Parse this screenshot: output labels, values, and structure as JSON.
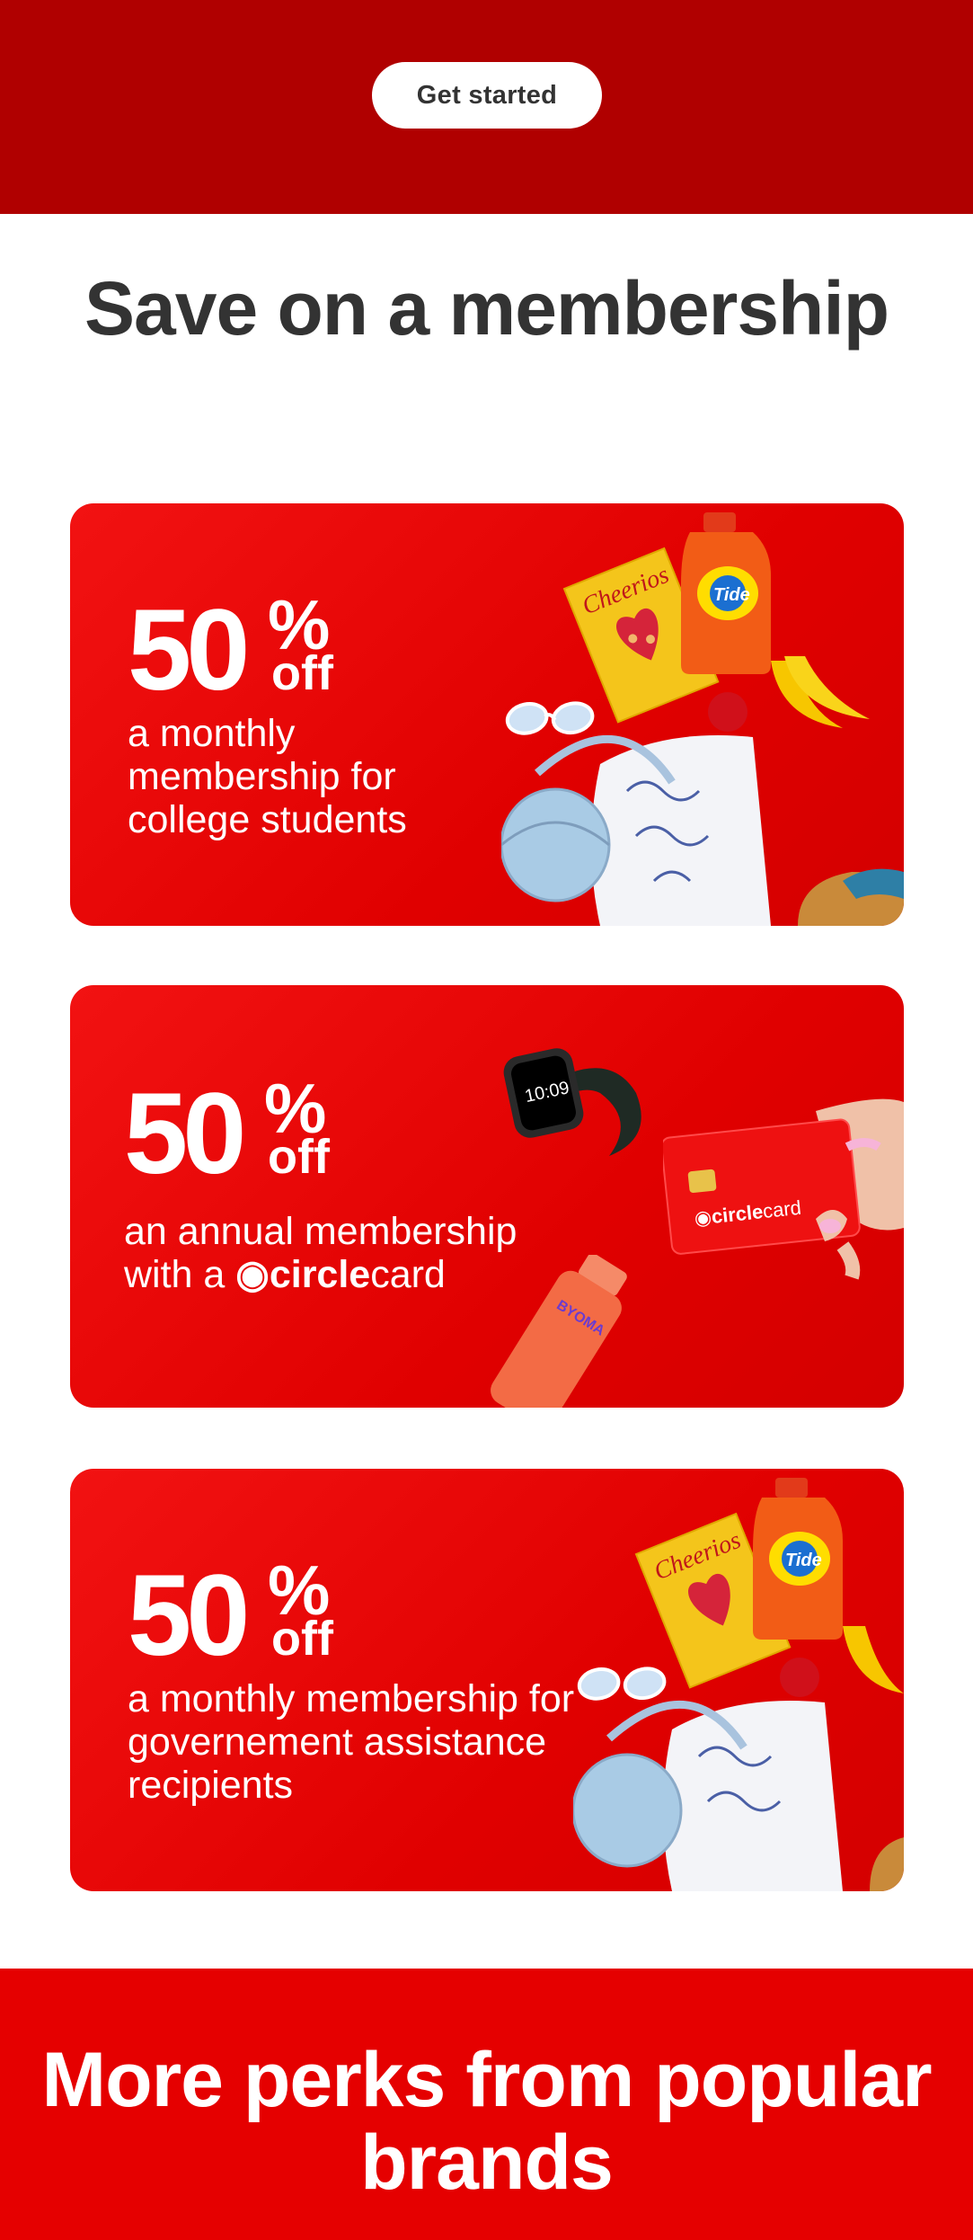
{
  "header": {
    "cta_label": "Get started"
  },
  "section": {
    "heading": "Save on a membership"
  },
  "offers": [
    {
      "percent": "50",
      "percent_symbol": "%",
      "off": "off",
      "description": "a monthly membership for college students"
    },
    {
      "percent": "50",
      "percent_symbol": "%",
      "off": "off",
      "description_prefix": "an annual membership",
      "description_line2_prefix": "with a",
      "circle_brand": "circle",
      "circle_card": "card",
      "card_brand": "circle",
      "card_word": "card"
    },
    {
      "percent": "50",
      "percent_symbol": "%",
      "off": "off",
      "description": "a monthly membership for governement assistance recipients"
    }
  ],
  "product_labels": {
    "cereal": "Cheerios",
    "detergent": "Tide",
    "watch_time": "10:09",
    "bottle": "BYOMA"
  },
  "footer": {
    "heading": "More perks from popular brands"
  },
  "colors": {
    "top_band": "#b00000",
    "card_red": "#e60000",
    "bottom_band": "#e50000",
    "heading_text": "#333333"
  }
}
